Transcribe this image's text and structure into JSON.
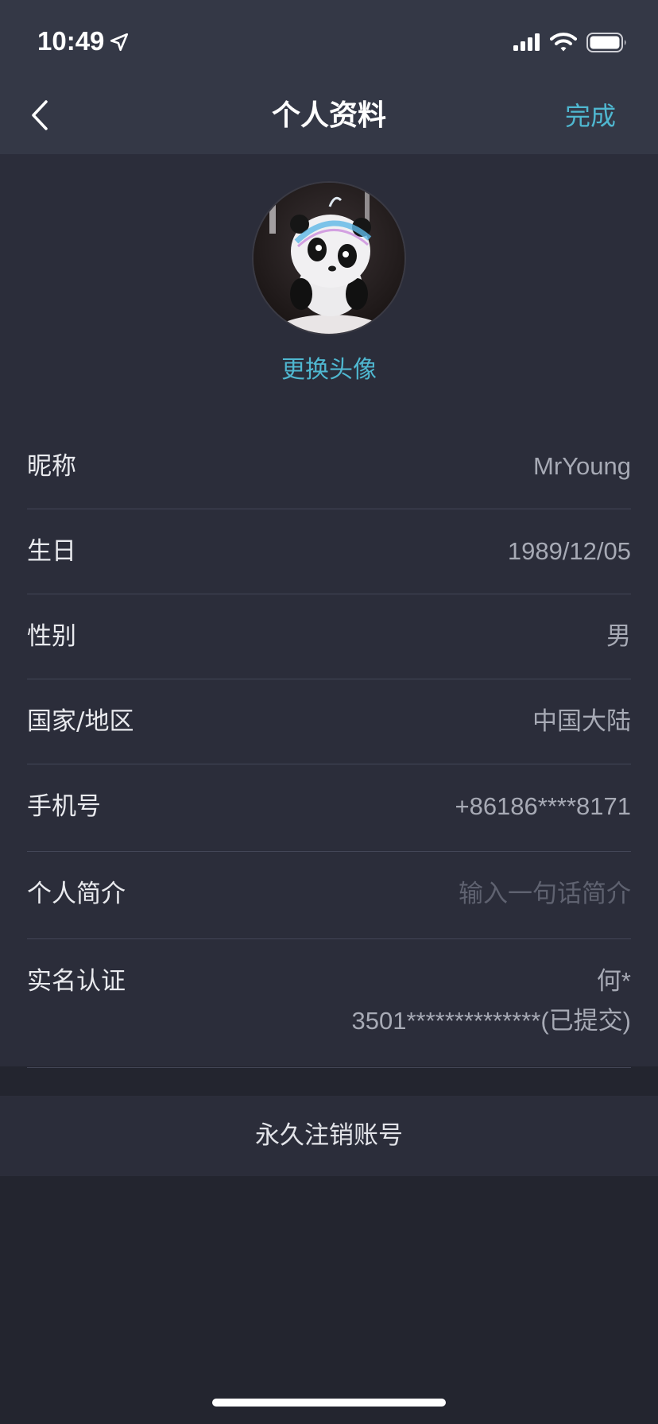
{
  "status_bar": {
    "time": "10:49",
    "icons": [
      "location-arrow-icon",
      "cellular-signal-icon",
      "wifi-icon",
      "battery-icon"
    ]
  },
  "nav": {
    "back_icon": "chevron-left-icon",
    "title": "个人资料",
    "done_label": "完成"
  },
  "profile": {
    "change_avatar_label": "更换头像",
    "rows": [
      {
        "label": "昵称",
        "value": "MrYoung"
      },
      {
        "label": "生日",
        "value": "1989/12/05"
      },
      {
        "label": "性别",
        "value": "男"
      },
      {
        "label": "国家/地区",
        "value": "中国大陆"
      },
      {
        "label": "手机号",
        "value": "+86186****8171"
      },
      {
        "label": "个人简介",
        "placeholder": "输入一句话简介"
      },
      {
        "label": "实名认证",
        "value_line1": "何*",
        "value_line2": "3501**************(已提交)"
      }
    ]
  },
  "deactivate_label": "永久注销账号",
  "colors": {
    "accent": "#4fb7d0",
    "nav_background": "#343846",
    "card_background": "#2b2d3a",
    "page_background": "#23252f"
  }
}
